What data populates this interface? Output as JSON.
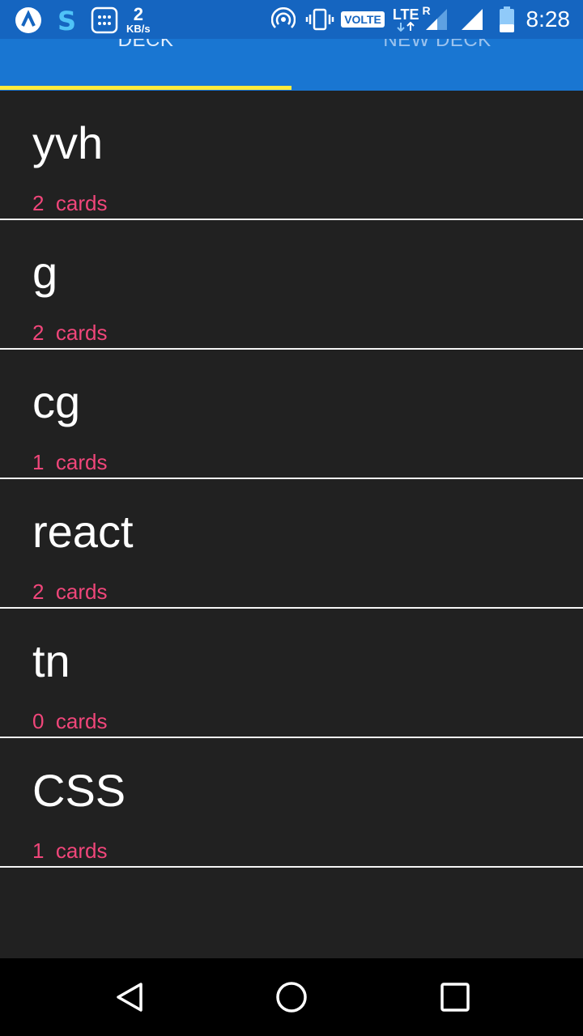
{
  "status_bar": {
    "data_rate_value": "2",
    "data_rate_unit": "KB/s",
    "volte_label": "VOLTE",
    "lte_label": "LTE",
    "roaming_label": "R",
    "time": "8:28",
    "icons": [
      "app-a-icon",
      "s-app-icon",
      "calculator-icon",
      "hotspot-icon",
      "vibrate-icon",
      "volte-icon",
      "lte-icon",
      "signal-roaming-icon",
      "signal-icon",
      "battery-icon"
    ]
  },
  "tabs": [
    {
      "label": "DECK",
      "active": true
    },
    {
      "label": "NEW DECK",
      "active": false
    }
  ],
  "decks": [
    {
      "title": "yvh",
      "count": "2",
      "count_suffix": "cards"
    },
    {
      "title": "g",
      "count": "2",
      "count_suffix": "cards"
    },
    {
      "title": "cg",
      "count": "1",
      "count_suffix": "cards"
    },
    {
      "title": "react",
      "count": "2",
      "count_suffix": "cards"
    },
    {
      "title": "tn",
      "count": "0",
      "count_suffix": "cards"
    },
    {
      "title": "CSS",
      "count": "1",
      "count_suffix": "cards"
    }
  ],
  "nav_bar": {
    "icons": [
      "back-icon",
      "home-icon",
      "recents-icon"
    ]
  },
  "colors": {
    "tab_bar": "#1976d2",
    "indicator": "#ffeb3b",
    "background": "#212121",
    "count_text": "#f0467a"
  }
}
